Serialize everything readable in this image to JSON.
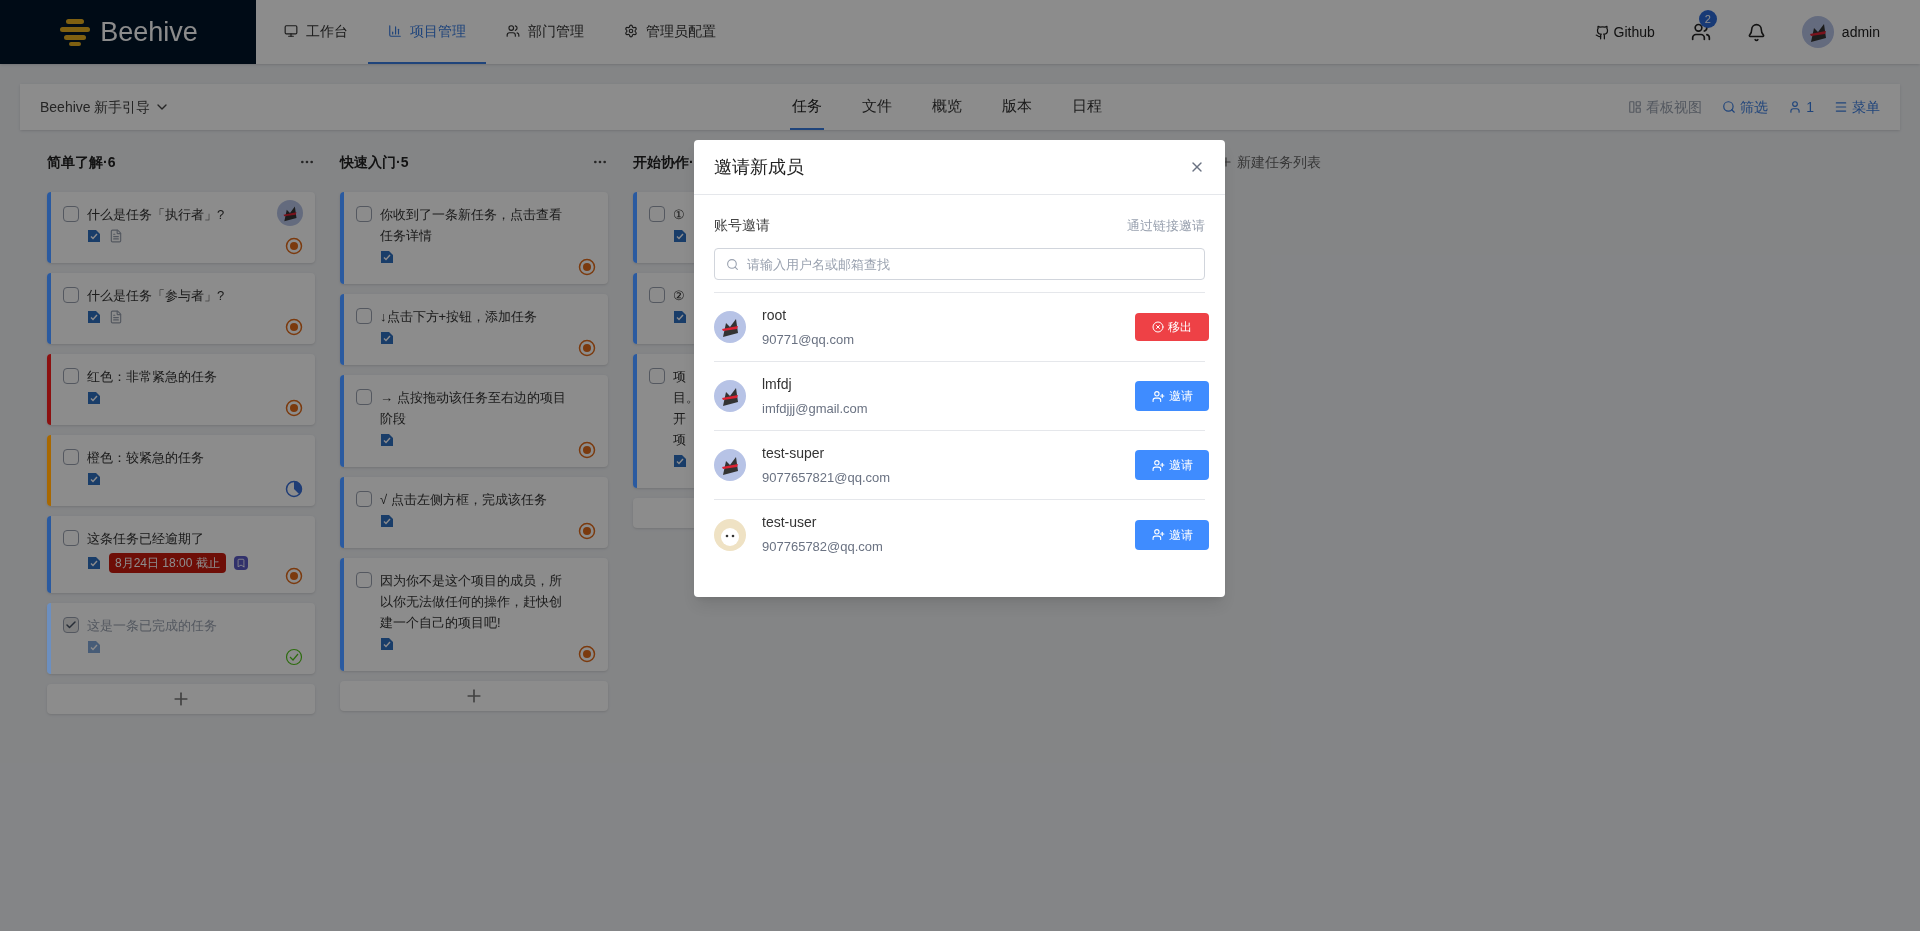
{
  "brand": "Beehive",
  "nav": [
    {
      "label": "工作台",
      "selected": false
    },
    {
      "label": "项目管理",
      "selected": true
    },
    {
      "label": "部门管理",
      "selected": false
    },
    {
      "label": "管理员配置",
      "selected": false
    }
  ],
  "header_right": {
    "github": "Github",
    "team_badge": "2",
    "user": "admin"
  },
  "project": {
    "name": "Beehive 新手引导"
  },
  "tabs": [
    {
      "label": "任务",
      "selected": true
    },
    {
      "label": "文件",
      "selected": false
    },
    {
      "label": "概览",
      "selected": false
    },
    {
      "label": "版本",
      "selected": false
    },
    {
      "label": "日程",
      "selected": false
    }
  ],
  "toolbar": [
    {
      "label": "看板视图",
      "kind": "board",
      "disabled": true
    },
    {
      "label": "筛选",
      "kind": "filter",
      "disabled": false
    },
    {
      "label": "1",
      "kind": "member",
      "disabled": false
    },
    {
      "label": "菜单",
      "kind": "menu",
      "disabled": false
    }
  ],
  "columns": [
    {
      "title": "简单了解·6",
      "cards": [
        {
          "title": "什么是任务「执行者」?",
          "color": "#2a5aa0",
          "checked": false,
          "doc": true,
          "assignee": true,
          "kind": "todo"
        },
        {
          "title": "什么是任务「参与者」?",
          "color": "#2a5aa0",
          "checked": false,
          "doc": true,
          "assignee": false,
          "kind": "todo"
        },
        {
          "title": "红色：非常紧急的任务",
          "color": "#8c1010",
          "checked": false,
          "doc": false,
          "assignee": false,
          "kind": "todo"
        },
        {
          "title": "橙色：较紧急的任务",
          "color": "#a86800",
          "checked": false,
          "doc": false,
          "assignee": false,
          "kind": "half"
        },
        {
          "title": "这条任务已经逾期了",
          "color": "#2a5aa0",
          "checked": false,
          "doc": false,
          "assignee": false,
          "kind": "todo",
          "due": "8月24日 18:00 截止"
        },
        {
          "title": "这是一条已完成的任务",
          "color": "#6c8fc0",
          "checked": true,
          "doc": false,
          "assignee": false,
          "kind": "done"
        }
      ]
    },
    {
      "title": "快速入门·5",
      "cards": [
        {
          "title": "你收到了一条新任务，点击查看任务详情",
          "color": "#2a5aa0",
          "checked": false,
          "doc": false,
          "assignee": false,
          "kind": "todo"
        },
        {
          "title": "↓点击下方+按钮，添加任务",
          "color": "#2a5aa0",
          "checked": false,
          "doc": false,
          "assignee": false,
          "kind": "todo"
        },
        {
          "title": "→ 点按拖动该任务至右边的项目阶段",
          "color": "#2a5aa0",
          "checked": false,
          "doc": false,
          "assignee": false,
          "kind": "todo"
        },
        {
          "title": "√ 点击左侧方框，完成该任务",
          "color": "#2a5aa0",
          "checked": false,
          "doc": false,
          "assignee": false,
          "kind": "todo"
        },
        {
          "title": "因为你不是这个项目的成员，所以你无法做任何的操作，赶快创建一个自己的项目吧!",
          "color": "#2a5aa0",
          "checked": false,
          "doc": false,
          "assignee": false,
          "kind": "todo"
        }
      ]
    },
    {
      "title": "开始协作·",
      "cards": [
        {
          "title": "①",
          "color": "#2a5aa0",
          "checked": false,
          "doc": false,
          "assignee": false,
          "kind": "hidden"
        },
        {
          "title": "②",
          "color": "#2a5aa0",
          "checked": false,
          "doc": false,
          "assignee": false,
          "kind": "hidden"
        },
        {
          "lines": [
            "项",
            "目。",
            "开",
            "项"
          ],
          "color": "#2a5aa0",
          "checked": false,
          "doc": false,
          "assignee": false,
          "kind": "hidden"
        }
      ]
    }
  ],
  "new_list": "新建任务列表",
  "dialog": {
    "title": "邀请新成员",
    "section": "账号邀请",
    "link_invite": "通过链接邀请",
    "search": {
      "placeholder": "请输入用户名或邮箱查找"
    },
    "members": [
      {
        "name": "root",
        "email": "90771@qq.com",
        "kind": "cat",
        "action": {
          "kind": "remove",
          "label": "移出"
        }
      },
      {
        "name": "lmfdj",
        "email": "imfdjjj@gmail.com",
        "kind": "cat",
        "action": {
          "kind": "invite",
          "label": "邀请"
        }
      },
      {
        "name": "test-super",
        "email": "9077657821@qq.com",
        "kind": "cat",
        "action": {
          "kind": "invite",
          "label": "邀请"
        }
      },
      {
        "name": "test-user",
        "email": "907765782@qq.com",
        "kind": "kitten",
        "action": {
          "kind": "invite",
          "label": "邀请"
        }
      }
    ]
  }
}
